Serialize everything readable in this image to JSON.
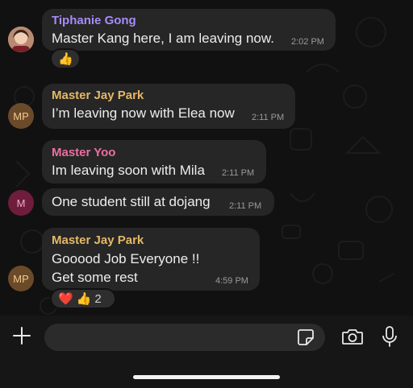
{
  "theme": {
    "name_purple": "#a78bfa",
    "name_gold": "#e5b867",
    "name_pink": "#ec6fa0",
    "mp_avatar_bg": "#6b4a2a",
    "mp_avatar_fg": "#f1c98e",
    "m_avatar_bg": "#6e1d3b",
    "m_avatar_fg": "#f2a9c4"
  },
  "messages": [
    {
      "sender": "Tiphanie Gong",
      "text": "Master Kang here, I am leaving now.",
      "time": "2:02 PM",
      "reaction": "👍"
    },
    {
      "sender": "Master Jay Park",
      "avatar_initials": "MP",
      "text": "I’m leaving now with Elea now",
      "time": "2:11 PM"
    },
    {
      "sender": "Master Yoo",
      "text": "Im leaving soon with Mila",
      "time": "2:11 PM"
    },
    {
      "avatar_initials": "M",
      "text": "One student still at dojang",
      "time": "2:11 PM"
    },
    {
      "sender": "Master Jay Park",
      "avatar_initials": "MP",
      "line1": "Gooood Job Everyone !!",
      "line2": "Get some rest",
      "time": "4:59 PM",
      "reactions": [
        "❤️",
        "👍"
      ],
      "reaction_count": "2"
    }
  ],
  "composer": {
    "icons": [
      "plus-icon",
      "sticker-icon",
      "camera-icon",
      "microphone-icon"
    ]
  }
}
